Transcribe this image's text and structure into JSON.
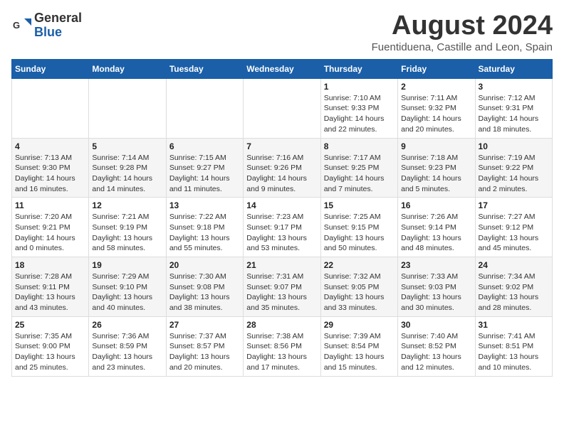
{
  "header": {
    "logo_general": "General",
    "logo_blue": "Blue",
    "main_title": "August 2024",
    "subtitle": "Fuentiduena, Castille and Leon, Spain"
  },
  "columns": [
    "Sunday",
    "Monday",
    "Tuesday",
    "Wednesday",
    "Thursday",
    "Friday",
    "Saturday"
  ],
  "weeks": [
    [
      {
        "day": "",
        "info": ""
      },
      {
        "day": "",
        "info": ""
      },
      {
        "day": "",
        "info": ""
      },
      {
        "day": "",
        "info": ""
      },
      {
        "day": "1",
        "info": "Sunrise: 7:10 AM\nSunset: 9:33 PM\nDaylight: 14 hours\nand 22 minutes."
      },
      {
        "day": "2",
        "info": "Sunrise: 7:11 AM\nSunset: 9:32 PM\nDaylight: 14 hours\nand 20 minutes."
      },
      {
        "day": "3",
        "info": "Sunrise: 7:12 AM\nSunset: 9:31 PM\nDaylight: 14 hours\nand 18 minutes."
      }
    ],
    [
      {
        "day": "4",
        "info": "Sunrise: 7:13 AM\nSunset: 9:30 PM\nDaylight: 14 hours\nand 16 minutes."
      },
      {
        "day": "5",
        "info": "Sunrise: 7:14 AM\nSunset: 9:28 PM\nDaylight: 14 hours\nand 14 minutes."
      },
      {
        "day": "6",
        "info": "Sunrise: 7:15 AM\nSunset: 9:27 PM\nDaylight: 14 hours\nand 11 minutes."
      },
      {
        "day": "7",
        "info": "Sunrise: 7:16 AM\nSunset: 9:26 PM\nDaylight: 14 hours\nand 9 minutes."
      },
      {
        "day": "8",
        "info": "Sunrise: 7:17 AM\nSunset: 9:25 PM\nDaylight: 14 hours\nand 7 minutes."
      },
      {
        "day": "9",
        "info": "Sunrise: 7:18 AM\nSunset: 9:23 PM\nDaylight: 14 hours\nand 5 minutes."
      },
      {
        "day": "10",
        "info": "Sunrise: 7:19 AM\nSunset: 9:22 PM\nDaylight: 14 hours\nand 2 minutes."
      }
    ],
    [
      {
        "day": "11",
        "info": "Sunrise: 7:20 AM\nSunset: 9:21 PM\nDaylight: 14 hours\nand 0 minutes."
      },
      {
        "day": "12",
        "info": "Sunrise: 7:21 AM\nSunset: 9:19 PM\nDaylight: 13 hours\nand 58 minutes."
      },
      {
        "day": "13",
        "info": "Sunrise: 7:22 AM\nSunset: 9:18 PM\nDaylight: 13 hours\nand 55 minutes."
      },
      {
        "day": "14",
        "info": "Sunrise: 7:23 AM\nSunset: 9:17 PM\nDaylight: 13 hours\nand 53 minutes."
      },
      {
        "day": "15",
        "info": "Sunrise: 7:25 AM\nSunset: 9:15 PM\nDaylight: 13 hours\nand 50 minutes."
      },
      {
        "day": "16",
        "info": "Sunrise: 7:26 AM\nSunset: 9:14 PM\nDaylight: 13 hours\nand 48 minutes."
      },
      {
        "day": "17",
        "info": "Sunrise: 7:27 AM\nSunset: 9:12 PM\nDaylight: 13 hours\nand 45 minutes."
      }
    ],
    [
      {
        "day": "18",
        "info": "Sunrise: 7:28 AM\nSunset: 9:11 PM\nDaylight: 13 hours\nand 43 minutes."
      },
      {
        "day": "19",
        "info": "Sunrise: 7:29 AM\nSunset: 9:10 PM\nDaylight: 13 hours\nand 40 minutes."
      },
      {
        "day": "20",
        "info": "Sunrise: 7:30 AM\nSunset: 9:08 PM\nDaylight: 13 hours\nand 38 minutes."
      },
      {
        "day": "21",
        "info": "Sunrise: 7:31 AM\nSunset: 9:07 PM\nDaylight: 13 hours\nand 35 minutes."
      },
      {
        "day": "22",
        "info": "Sunrise: 7:32 AM\nSunset: 9:05 PM\nDaylight: 13 hours\nand 33 minutes."
      },
      {
        "day": "23",
        "info": "Sunrise: 7:33 AM\nSunset: 9:03 PM\nDaylight: 13 hours\nand 30 minutes."
      },
      {
        "day": "24",
        "info": "Sunrise: 7:34 AM\nSunset: 9:02 PM\nDaylight: 13 hours\nand 28 minutes."
      }
    ],
    [
      {
        "day": "25",
        "info": "Sunrise: 7:35 AM\nSunset: 9:00 PM\nDaylight: 13 hours\nand 25 minutes."
      },
      {
        "day": "26",
        "info": "Sunrise: 7:36 AM\nSunset: 8:59 PM\nDaylight: 13 hours\nand 23 minutes."
      },
      {
        "day": "27",
        "info": "Sunrise: 7:37 AM\nSunset: 8:57 PM\nDaylight: 13 hours\nand 20 minutes."
      },
      {
        "day": "28",
        "info": "Sunrise: 7:38 AM\nSunset: 8:56 PM\nDaylight: 13 hours\nand 17 minutes."
      },
      {
        "day": "29",
        "info": "Sunrise: 7:39 AM\nSunset: 8:54 PM\nDaylight: 13 hours\nand 15 minutes."
      },
      {
        "day": "30",
        "info": "Sunrise: 7:40 AM\nSunset: 8:52 PM\nDaylight: 13 hours\nand 12 minutes."
      },
      {
        "day": "31",
        "info": "Sunrise: 7:41 AM\nSunset: 8:51 PM\nDaylight: 13 hours\nand 10 minutes."
      }
    ]
  ]
}
